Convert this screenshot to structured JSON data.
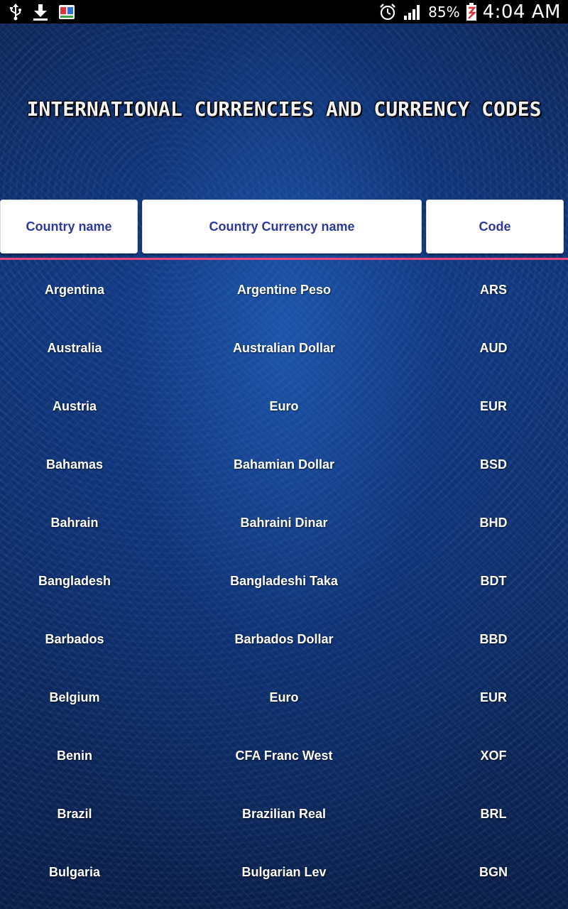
{
  "status_bar": {
    "battery_percent": "85%",
    "time": "4:04 AM",
    "icons": [
      "usb-icon",
      "download-icon",
      "app-notification-icon",
      "alarm-icon",
      "signal-icon",
      "battery-icon"
    ]
  },
  "app": {
    "title": "INTERNATIONAL CURRENCIES AND CURRENCY CODES"
  },
  "table": {
    "headers": {
      "country": "Country name",
      "currency": "Country Currency name",
      "code": "Code"
    },
    "rows": [
      {
        "country": "Argentina",
        "currency": "Argentine Peso",
        "code": "ARS"
      },
      {
        "country": "Australia",
        "currency": "Australian Dollar",
        "code": "AUD"
      },
      {
        "country": "Austria",
        "currency": "Euro",
        "code": "EUR"
      },
      {
        "country": "Bahamas",
        "currency": "Bahamian Dollar",
        "code": "BSD"
      },
      {
        "country": "Bahrain",
        "currency": "Bahraini Dinar",
        "code": "BHD"
      },
      {
        "country": "Bangladesh",
        "currency": "Bangladeshi Taka",
        "code": "BDT"
      },
      {
        "country": "Barbados",
        "currency": "Barbados Dollar",
        "code": "BBD"
      },
      {
        "country": "Belgium",
        "currency": "Euro",
        "code": "EUR"
      },
      {
        "country": "Benin",
        "currency": "CFA Franc West",
        "code": "XOF"
      },
      {
        "country": "Brazil",
        "currency": "Brazilian Real",
        "code": "BRL"
      },
      {
        "country": "Bulgaria",
        "currency": "Bulgarian Lev",
        "code": "BGN"
      }
    ]
  },
  "colors": {
    "header_text": "#2c3a9e",
    "divider": "#e8467c",
    "row_text": "#ffffff",
    "background": "#123a86"
  }
}
